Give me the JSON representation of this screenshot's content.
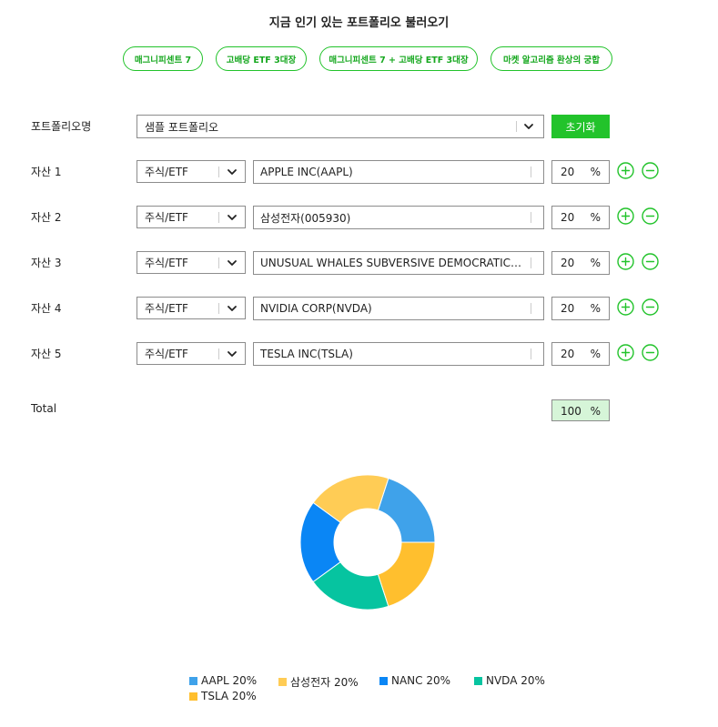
{
  "header": {
    "title": "지금 인기 있는 포트폴리오 불러오기"
  },
  "presets": [
    "매그니피센트 7",
    "고배당 ETF 3대장",
    "매그니피센트 7 + 고배당 ETF 3대장",
    "마켓 알고리즘 환상의 궁합"
  ],
  "portfolio": {
    "label": "포트폴리오명",
    "selected": "샘플 포트폴리오",
    "reset_label": "초기화"
  },
  "assets": [
    {
      "label": "자산 1",
      "type": "주식/ETF",
      "name": "APPLE INC(AAPL)",
      "weight": "20",
      "unit": "%"
    },
    {
      "label": "자산 2",
      "type": "주식/ETF",
      "name": "삼성전자(005930)",
      "weight": "20",
      "unit": "%"
    },
    {
      "label": "자산 3",
      "type": "주식/ETF",
      "name": "UNUSUAL WHALES SUBVERSIVE DEMOCRATIC ...",
      "weight": "20",
      "unit": "%"
    },
    {
      "label": "자산 4",
      "type": "주식/ETF",
      "name": "NVIDIA CORP(NVDA)",
      "weight": "20",
      "unit": "%"
    },
    {
      "label": "자산 5",
      "type": "주식/ETF",
      "name": "TESLA INC(TSLA)",
      "weight": "20",
      "unit": "%"
    }
  ],
  "total": {
    "label": "Total",
    "value": "100",
    "unit": "%"
  },
  "colors": {
    "accent": "#22c32b",
    "total_bg": "#d6f5d8"
  },
  "icons": {
    "add": "plus-circle-icon",
    "remove": "minus-circle-icon",
    "dropdown": "chevron-down-icon"
  },
  "chart_data": {
    "type": "pie",
    "donut": true,
    "series": [
      {
        "name": "AAPL",
        "value": 20,
        "color": "#3fa2ea"
      },
      {
        "name": "삼성전자",
        "value": 20,
        "color": "#ffcc55"
      },
      {
        "name": "NANC",
        "value": 20,
        "color": "#0a86f5"
      },
      {
        "name": "NVDA",
        "value": 20,
        "color": "#06c4a0"
      },
      {
        "name": "TSLA",
        "value": 20,
        "color": "#ffbf2e"
      }
    ],
    "legend": [
      "AAPL 20%",
      "삼성전자 20%",
      "NANC 20%",
      "NVDA 20%",
      "TSLA 20%"
    ],
    "legend_position": "bottom"
  }
}
